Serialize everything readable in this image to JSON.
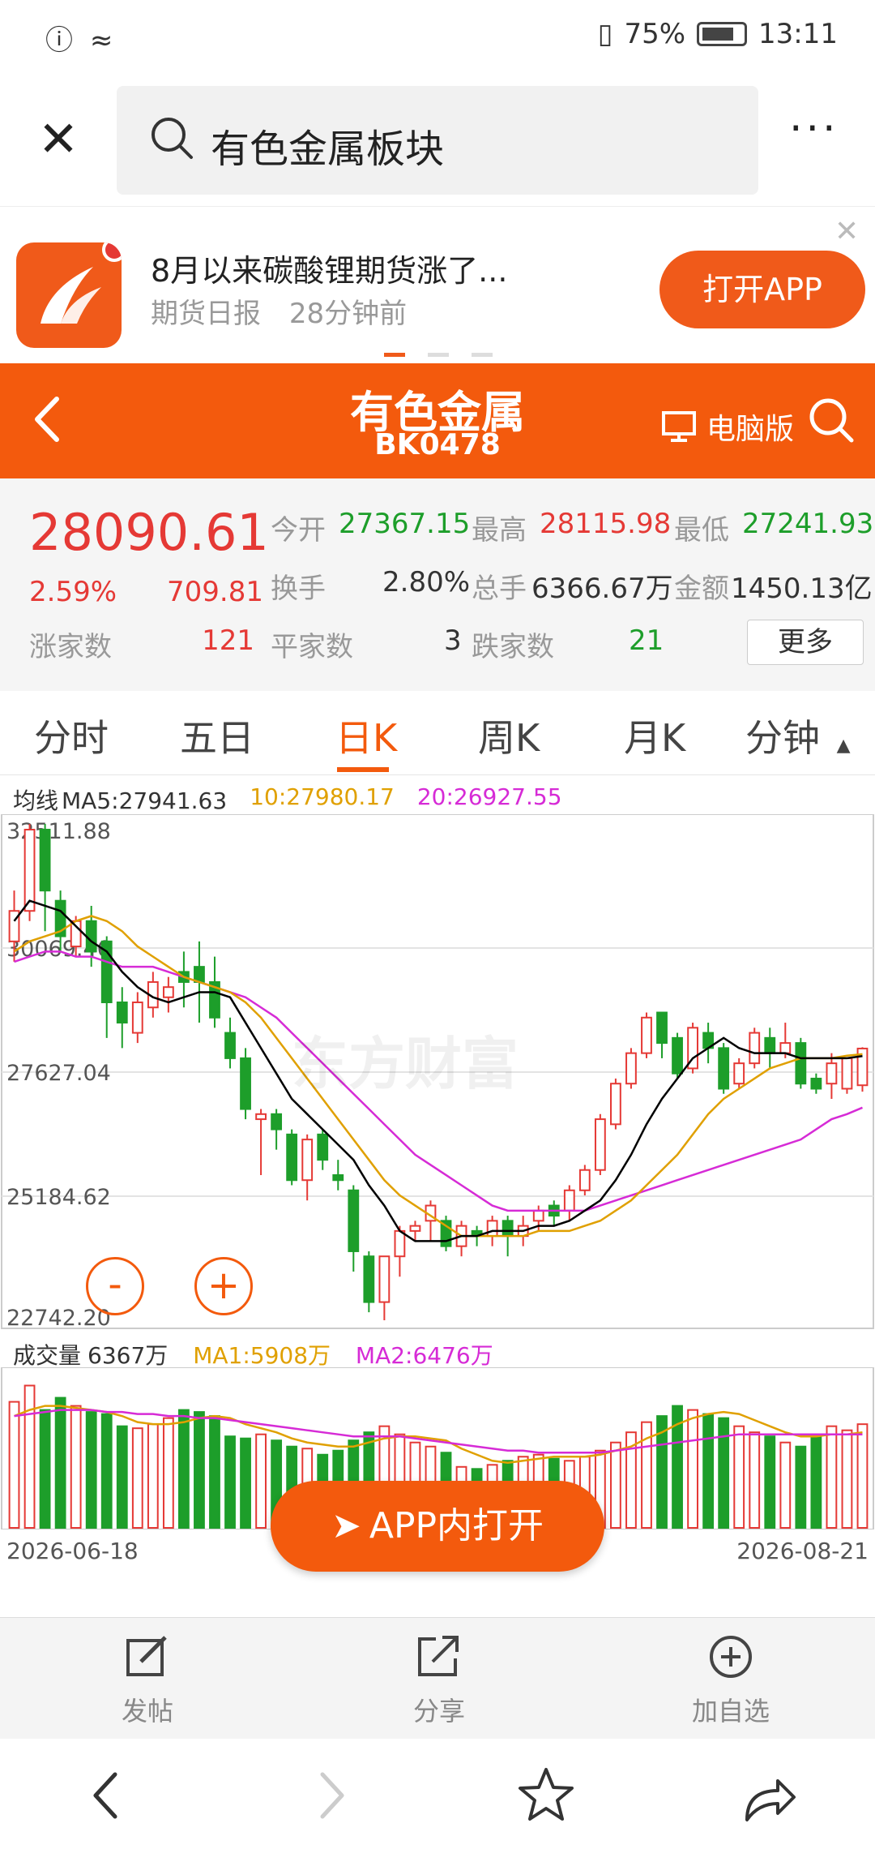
{
  "status_bar": {
    "battery": "75%",
    "time": "13:11"
  },
  "search": {
    "query": "有色金属板块"
  },
  "news": {
    "title": "8月以来碳酸锂期货涨了...",
    "source": "期货日报",
    "time_ago": "28分钟前",
    "open_app_label": "打开APP"
  },
  "header": {
    "title": "有色金属",
    "code": "BK0478",
    "pc_label": "电脑版"
  },
  "quote": {
    "price": "28090.61",
    "change_pct": "2.59%",
    "change_val": "709.81",
    "open_label": "今开",
    "open": "27367.15",
    "high_label": "最高",
    "high": "28115.98",
    "low_label": "最低",
    "low": "27241.93",
    "turnover_label": "换手",
    "turnover": "2.80%",
    "volume_label": "总手",
    "volume": "6366.67万",
    "amount_label": "金额",
    "amount": "1450.13亿",
    "up_label": "涨家数",
    "up": "121",
    "flat_label": "平家数",
    "flat": "3",
    "down_label": "跌家数",
    "down": "21",
    "more_label": "更多"
  },
  "tabs": [
    "分时",
    "五日",
    "日K",
    "周K",
    "月K",
    "分钟"
  ],
  "active_tab": "日K",
  "ma_legend": {
    "label": "均线",
    "ma5": "MA5:27941.63",
    "ma10": "10:27980.17",
    "ma20": "20:26927.55"
  },
  "vol_legend": {
    "label": "成交量",
    "value": "6367万",
    "ma1": "MA1:5908万",
    "ma2": "MA2:6476万"
  },
  "watermark": "东方财富",
  "zoom": {
    "out": "-",
    "in": "+"
  },
  "float_button": "APP内打开",
  "actions": {
    "post": "发帖",
    "share": "分享",
    "watch": "加自选"
  },
  "colors": {
    "brand": "#f35a0d",
    "up": "#e53935",
    "down": "#1d9e2a",
    "ma5": "#000000",
    "ma10": "#e0a000",
    "ma20": "#d62bd6"
  },
  "chart_data": {
    "type": "candlestick",
    "y_ticks": [
      "32511.88",
      "30069.46",
      "27627.04",
      "25184.62",
      "22742.20"
    ],
    "ylim": [
      22742.2,
      32511.88
    ],
    "x_range": [
      "2026-06-18",
      "2026-08-21"
    ],
    "candles": [
      [
        30200,
        30800,
        29800,
        31200
      ],
      [
        30800,
        32400,
        30600,
        32511
      ],
      [
        32400,
        31200,
        30400,
        32511
      ],
      [
        31000,
        30300,
        30000,
        31200
      ],
      [
        30100,
        30600,
        29900,
        30700
      ],
      [
        30600,
        30000,
        29700,
        30900
      ],
      [
        30200,
        29000,
        28300,
        30300
      ],
      [
        29000,
        28600,
        28100,
        29300
      ],
      [
        28400,
        29000,
        28200,
        29200
      ],
      [
        28900,
        29400,
        28700,
        29600
      ],
      [
        29100,
        29300,
        28800,
        29500
      ],
      [
        29600,
        29400,
        28900,
        30000
      ],
      [
        29700,
        29400,
        28600,
        30200
      ],
      [
        29400,
        28700,
        28500,
        29900
      ],
      [
        28400,
        27900,
        27700,
        28700
      ],
      [
        27900,
        26900,
        26700,
        28100
      ],
      [
        26700,
        26800,
        25600,
        26900
      ],
      [
        26800,
        26500,
        26100,
        26900
      ],
      [
        26400,
        25500,
        25400,
        26500
      ],
      [
        25500,
        26300,
        25100,
        26400
      ],
      [
        26400,
        25900,
        25700,
        26500
      ],
      [
        25600,
        25500,
        25300,
        25900
      ],
      [
        25300,
        24100,
        23700,
        25400
      ],
      [
        24000,
        23100,
        22900,
        24100
      ],
      [
        23100,
        24000,
        22742,
        24000
      ],
      [
        24000,
        24500,
        23600,
        24600
      ],
      [
        24500,
        24600,
        24300,
        24700
      ],
      [
        24700,
        25000,
        24300,
        25100
      ],
      [
        24700,
        24200,
        24100,
        24800
      ],
      [
        24200,
        24600,
        24000,
        24700
      ],
      [
        24500,
        24400,
        24200,
        24600
      ],
      [
        24400,
        24700,
        24200,
        24800
      ],
      [
        24700,
        24400,
        24000,
        24800
      ],
      [
        24400,
        24600,
        24200,
        24800
      ],
      [
        24700,
        24900,
        24500,
        25000
      ],
      [
        25000,
        24800,
        24600,
        25100
      ],
      [
        24900,
        25300,
        24700,
        25400
      ],
      [
        25300,
        25700,
        25200,
        25800
      ],
      [
        25700,
        26700,
        25600,
        26800
      ],
      [
        26600,
        27400,
        26500,
        27500
      ],
      [
        27400,
        28000,
        27300,
        28100
      ],
      [
        28000,
        28700,
        27900,
        28800
      ],
      [
        28800,
        28200,
        27900,
        28800
      ],
      [
        28300,
        27600,
        27500,
        28400
      ],
      [
        27700,
        28500,
        27600,
        28600
      ],
      [
        28400,
        28100,
        27800,
        28600
      ],
      [
        28100,
        27300,
        27200,
        28200
      ],
      [
        27400,
        27800,
        27300,
        27900
      ],
      [
        27800,
        28400,
        27700,
        28500
      ],
      [
        28300,
        28000,
        27700,
        28500
      ],
      [
        28000,
        28200,
        27900,
        28600
      ],
      [
        28200,
        27400,
        27300,
        28300
      ],
      [
        27500,
        27300,
        27200,
        27600
      ],
      [
        27400,
        27800,
        27100,
        28000
      ],
      [
        27300,
        27900,
        27200,
        27900
      ],
      [
        27368,
        28091,
        27242,
        28116
      ]
    ],
    "ma5": [
      30600,
      31000,
      30900,
      30800,
      30500,
      30200,
      30000,
      29600,
      29300,
      29100,
      29000,
      29100,
      29200,
      29200,
      29100,
      28600,
      28100,
      27600,
      27100,
      26800,
      26500,
      26200,
      25900,
      25400,
      25000,
      24500,
      24300,
      24300,
      24300,
      24400,
      24400,
      24500,
      24500,
      24500,
      24600,
      24600,
      24700,
      24900,
      25100,
      25500,
      26000,
      26600,
      27100,
      27500,
      27900,
      28100,
      28300,
      28100,
      28000,
      28000,
      28000,
      27900,
      27900,
      27900,
      27900,
      27942
    ],
    "ma10": [
      30000,
      30200,
      30300,
      30400,
      30600,
      30700,
      30600,
      30400,
      30100,
      29900,
      29700,
      29500,
      29400,
      29300,
      29200,
      29000,
      28700,
      28300,
      27900,
      27500,
      27100,
      26700,
      26300,
      25900,
      25500,
      25200,
      25000,
      24800,
      24600,
      24400,
      24400,
      24400,
      24400,
      24400,
      24500,
      24500,
      24500,
      24600,
      24700,
      24900,
      25100,
      25400,
      25700,
      26000,
      26400,
      26800,
      27100,
      27300,
      27500,
      27700,
      27800,
      27900,
      27900,
      27900,
      27950,
      27980
    ],
    "ma20": [
      29800,
      29900,
      30000,
      30000,
      29900,
      29900,
      29800,
      29700,
      29700,
      29700,
      29600,
      29500,
      29400,
      29300,
      29200,
      29100,
      28900,
      28700,
      28400,
      28100,
      27800,
      27500,
      27200,
      26900,
      26600,
      26300,
      26000,
      25800,
      25600,
      25400,
      25200,
      25000,
      24900,
      24900,
      24900,
      24900,
      24900,
      24900,
      25000,
      25100,
      25200,
      25300,
      25400,
      25500,
      25600,
      25700,
      25800,
      25900,
      26000,
      26100,
      26200,
      26300,
      26500,
      26700,
      26800,
      26928
    ],
    "volume": [
      62,
      70,
      58,
      64,
      60,
      57,
      56,
      50,
      49,
      51,
      54,
      58,
      57,
      55,
      45,
      44,
      46,
      43,
      40,
      39,
      36,
      38,
      43,
      47,
      50,
      46,
      42,
      40,
      37,
      30,
      29,
      31,
      33,
      35,
      36,
      34,
      33,
      35,
      38,
      42,
      47,
      52,
      55,
      60,
      58,
      56,
      54,
      50,
      47,
      45,
      42,
      40,
      46,
      50,
      48,
      51
    ],
    "vol_ma1": [
      55,
      58,
      60,
      60,
      59,
      58,
      57,
      55,
      52,
      51,
      51,
      52,
      54,
      55,
      54,
      51,
      49,
      47,
      44,
      42,
      41,
      40,
      40,
      42,
      44,
      45,
      45,
      44,
      43,
      39,
      36,
      33,
      32,
      33,
      34,
      35,
      35,
      35,
      36,
      38,
      40,
      44,
      47,
      51,
      54,
      56,
      57,
      56,
      53,
      50,
      47,
      45,
      45,
      46,
      46,
      47
    ],
    "vol_ma2": [
      55,
      56,
      57,
      58,
      58,
      58,
      57,
      57,
      56,
      56,
      55,
      55,
      54,
      54,
      53,
      52,
      51,
      50,
      49,
      48,
      47,
      46,
      45,
      45,
      45,
      45,
      44,
      43,
      42,
      41,
      40,
      39,
      38,
      38,
      37,
      37,
      37,
      37,
      37,
      38,
      39,
      40,
      41,
      42,
      43,
      44,
      45,
      46,
      46,
      46,
      46,
      46,
      46,
      46,
      46,
      46
    ],
    "vol_max": 75
  }
}
